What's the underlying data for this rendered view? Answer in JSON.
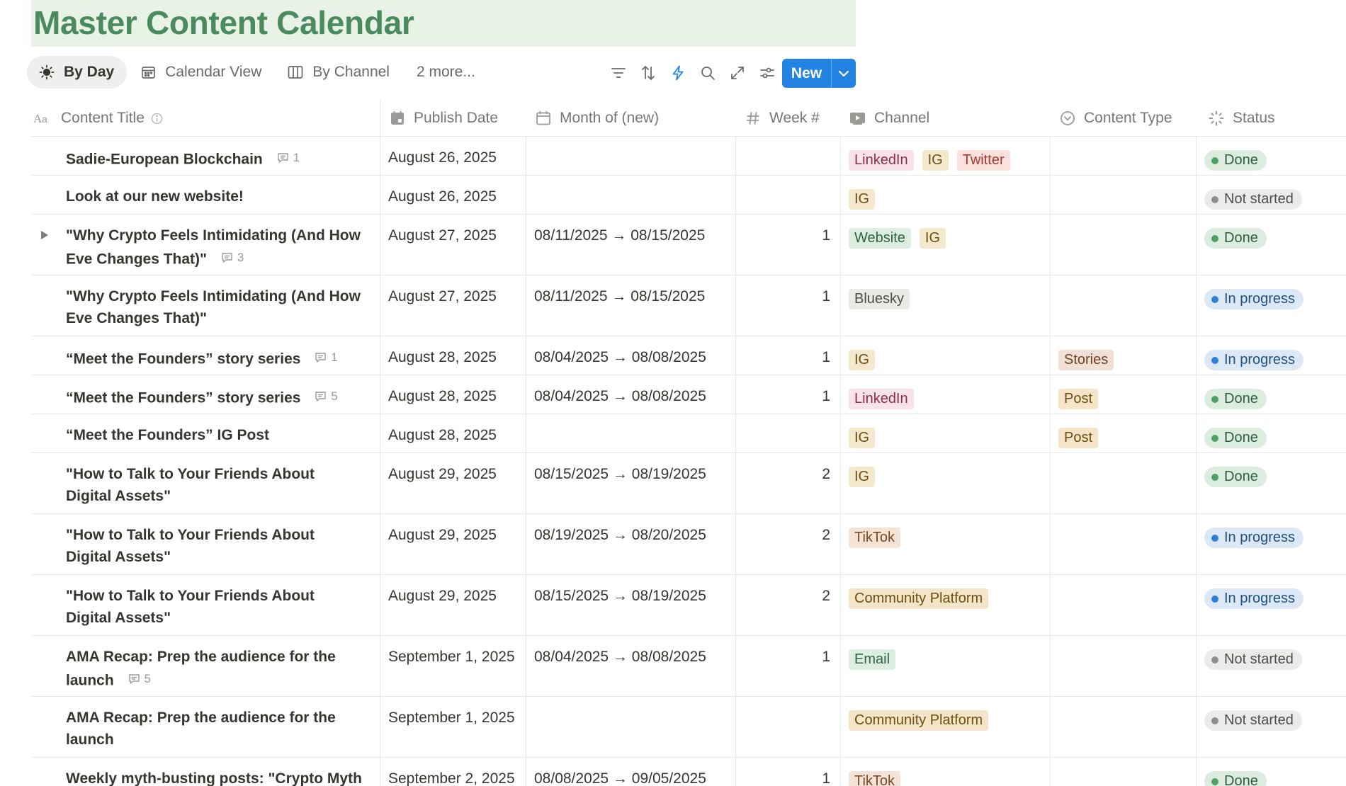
{
  "page": {
    "title": "Master Content Calendar"
  },
  "views": [
    {
      "label": "By Day",
      "icon": "sun-icon",
      "active": true
    },
    {
      "label": "Calendar View",
      "icon": "calendar-icon",
      "active": false
    },
    {
      "label": "By Channel",
      "icon": "board-icon",
      "active": false
    },
    {
      "label": "2 more...",
      "icon": "",
      "active": false
    }
  ],
  "toolbar": {
    "icons": [
      "filter-icon",
      "sort-icon",
      "automation-bolt-icon",
      "search-icon",
      "expand-icon",
      "settings-sliders-icon"
    ],
    "new_label": "New"
  },
  "columns": [
    {
      "key": "title",
      "label": "Content Title",
      "icon": "text-property-icon"
    },
    {
      "key": "date",
      "label": "Publish Date",
      "icon": "date-property-icon"
    },
    {
      "key": "month",
      "label": "Month of (new)",
      "icon": "calendar-property-icon"
    },
    {
      "key": "week",
      "label": "Week #",
      "icon": "number-property-icon"
    },
    {
      "key": "channel",
      "label": "Channel",
      "icon": "multiselect-property-icon"
    },
    {
      "key": "type",
      "label": "Content Type",
      "icon": "select-property-icon"
    },
    {
      "key": "status",
      "label": "Status",
      "icon": "status-property-icon"
    }
  ],
  "colors": {
    "LinkedIn": {
      "bg": "#f9e3ea",
      "fg": "#8a2c4d"
    },
    "IG": {
      "bg": "#f5e9cd",
      "fg": "#6b4e12"
    },
    "Twitter": {
      "bg": "#fbe0dc",
      "fg": "#a03a2f"
    },
    "Website": {
      "bg": "#ddeddf",
      "fg": "#2f6341"
    },
    "Bluesky": {
      "bg": "#eceae6",
      "fg": "#4f4d49"
    },
    "TikTok": {
      "bg": "#f5e4d6",
      "fg": "#7a4a25"
    },
    "Community Platform": {
      "bg": "#f5e5c8",
      "fg": "#6b4e12"
    },
    "Email": {
      "bg": "#ddeddf",
      "fg": "#2f6341"
    },
    "Stories": {
      "bg": "#f0e0d6",
      "fg": "#6e3f23"
    },
    "Post": {
      "bg": "#f5e4c8",
      "fg": "#6b4e12"
    },
    "Done": {
      "bg": "#dcecdf",
      "fg": "#2e5f3d",
      "dot": "#4da162"
    },
    "Not started": {
      "bg": "#ebebea",
      "fg": "#4f4d49",
      "dot": "#8f8e8a"
    },
    "In progress": {
      "bg": "#dce8f5",
      "fg": "#20527d",
      "dot": "#2f80d6"
    }
  },
  "rows": [
    {
      "title": "Sadie-European Blockchain",
      "comments": "1",
      "toggle": false,
      "date": "August 26, 2025",
      "month": "",
      "week": "",
      "channel": [
        "LinkedIn",
        "IG",
        "Twitter"
      ],
      "type": [],
      "status": "Done",
      "tall": false
    },
    {
      "title": "Look at our new website!",
      "comments": "",
      "toggle": false,
      "date": "August 26, 2025",
      "month": "",
      "week": "",
      "channel": [
        "IG"
      ],
      "type": [],
      "status": "Not started",
      "tall": false
    },
    {
      "title": "\"Why Crypto Feels Intimidating (And How Eve Changes That)\"",
      "comments": "3",
      "toggle": true,
      "date": "August 27, 2025",
      "month": "08/11/2025 → 08/15/2025",
      "week": "1",
      "channel": [
        "Website",
        "IG"
      ],
      "type": [],
      "status": "Done",
      "tall": true
    },
    {
      "title": "\"Why Crypto Feels Intimidating (And How Eve Changes That)\"",
      "comments": "",
      "toggle": false,
      "date": "August 27, 2025",
      "month": "08/11/2025 → 08/15/2025",
      "week": "1",
      "channel": [
        "Bluesky"
      ],
      "type": [],
      "status": "In progress",
      "tall": true
    },
    {
      "title": "“Meet the Founders” story series",
      "comments": "1",
      "toggle": false,
      "date": "August 28, 2025",
      "month": "08/04/2025 → 08/08/2025",
      "week": "1",
      "channel": [
        "IG"
      ],
      "type": [
        "Stories"
      ],
      "status": "In progress",
      "tall": false
    },
    {
      "title": "“Meet the Founders” story series",
      "comments": "5",
      "toggle": false,
      "date": "August 28, 2025",
      "month": "08/04/2025 → 08/08/2025",
      "week": "1",
      "channel": [
        "LinkedIn"
      ],
      "type": [
        "Post"
      ],
      "status": "Done",
      "tall": false
    },
    {
      "title": "“Meet the Founders” IG Post",
      "comments": "",
      "toggle": false,
      "date": "August 28, 2025",
      "month": "",
      "week": "",
      "channel": [
        "IG"
      ],
      "type": [
        "Post"
      ],
      "status": "Done",
      "tall": false
    },
    {
      "title": "\"How to Talk to Your Friends About Digital Assets\"",
      "comments": "",
      "toggle": false,
      "date": "August 29, 2025",
      "month": "08/15/2025 → 08/19/2025",
      "week": "2",
      "channel": [
        "IG"
      ],
      "type": [],
      "status": "Done",
      "tall": true
    },
    {
      "title": "\"How to Talk to Your Friends About Digital Assets\"",
      "comments": "",
      "toggle": false,
      "date": "August 29, 2025",
      "month": "08/19/2025 → 08/20/2025",
      "week": "2",
      "channel": [
        "TikTok"
      ],
      "type": [],
      "status": "In progress",
      "tall": true
    },
    {
      "title": "\"How to Talk to Your Friends About Digital Assets\"",
      "comments": "",
      "toggle": false,
      "date": "August 29, 2025",
      "month": "08/15/2025 → 08/19/2025",
      "week": "2",
      "channel": [
        "Community Platform"
      ],
      "type": [],
      "status": "In progress",
      "tall": true
    },
    {
      "title": "AMA Recap: Prep the audience for the launch",
      "comments": "5",
      "toggle": false,
      "date": "September 1, 2025",
      "month": "08/04/2025 → 08/08/2025",
      "week": "1",
      "channel": [
        "Email"
      ],
      "type": [],
      "status": "Not started",
      "tall": true
    },
    {
      "title": "AMA Recap: Prep the audience for the launch",
      "comments": "",
      "toggle": false,
      "date": "September 1, 2025",
      "month": "",
      "week": "",
      "channel": [
        "Community Platform"
      ],
      "type": [],
      "status": "Not started",
      "tall": true
    },
    {
      "title": "Weekly myth-busting posts: \"Crypto Myth",
      "comments": "",
      "toggle": false,
      "date": "September 2, 2025",
      "month": "08/08/2025 → 09/05/2025",
      "week": "1",
      "channel": [
        "TikTok"
      ],
      "type": [],
      "status": "Done",
      "tall": false
    }
  ]
}
